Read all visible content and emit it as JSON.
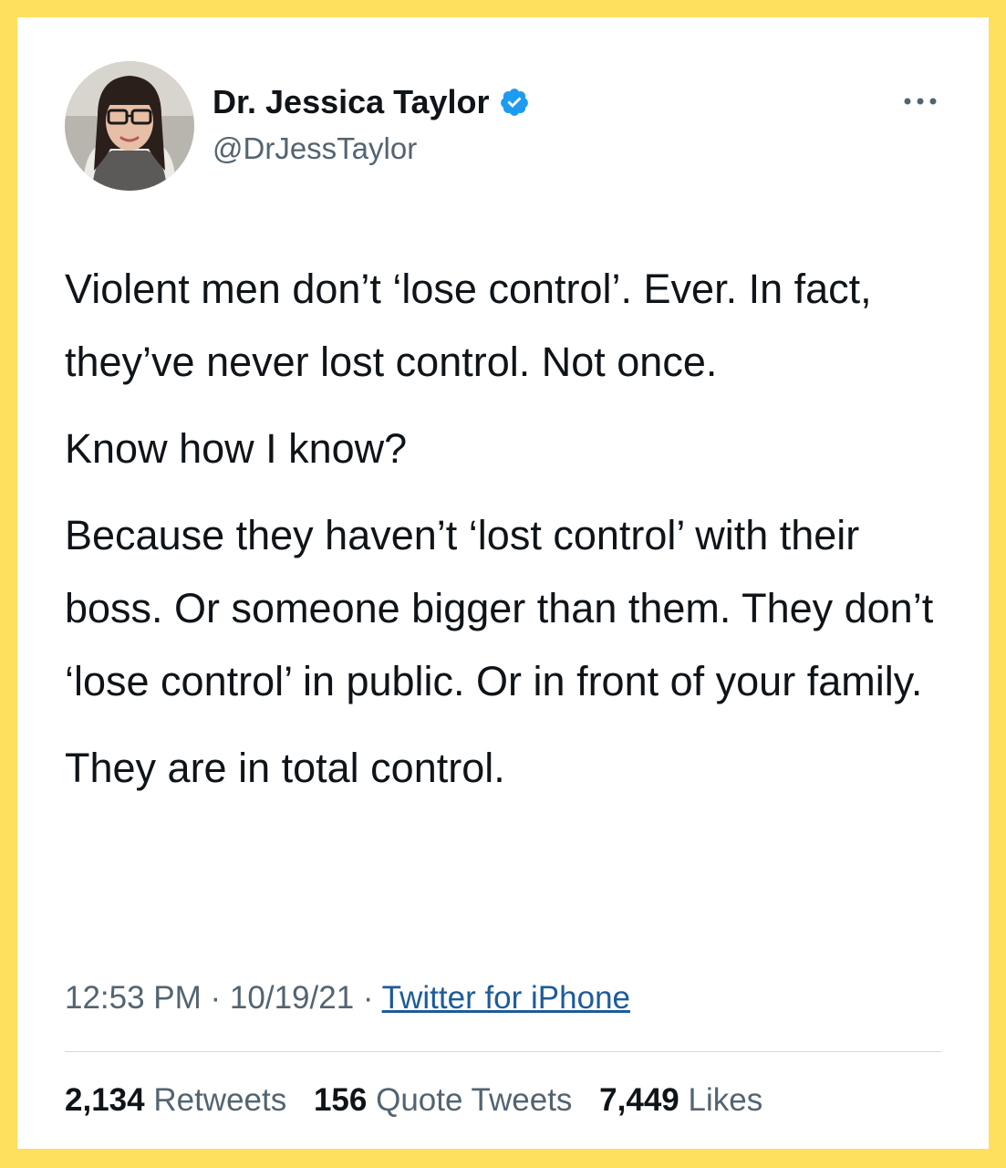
{
  "colors": {
    "frame": "#FFDF5E",
    "card": "#FFFFFF",
    "text_primary": "#0F1419",
    "text_secondary": "#536471",
    "verified": "#1D9BF0",
    "link": "#1D5B9A",
    "divider": "#CFD9DE"
  },
  "author": {
    "display_name": "Dr. Jessica Taylor",
    "handle": "@DrJessTaylor",
    "verified": true,
    "avatar_icon": "profile-photo",
    "verified_icon": "verified-badge-icon"
  },
  "menu": {
    "icon": "more-options-icon"
  },
  "tweet": {
    "paragraphs": [
      "Violent men don’t ‘lose control’. Ever. In fact, they’ve never lost control. Not once.",
      "Know how I know?",
      "Because they haven’t ‘lost control’ with their boss. Or someone bigger than them. They don’t ‘lose control’ in public. Or in front of your family.",
      "They are in total control."
    ]
  },
  "meta": {
    "time": "12:53 PM",
    "separator": " · ",
    "date": "10/19/21",
    "source": "Twitter for iPhone"
  },
  "stats": {
    "retweets": {
      "count": "2,134",
      "label": "Retweets"
    },
    "quotes": {
      "count": "156",
      "label": "Quote Tweets"
    },
    "likes": {
      "count": "7,449",
      "label": "Likes"
    }
  }
}
